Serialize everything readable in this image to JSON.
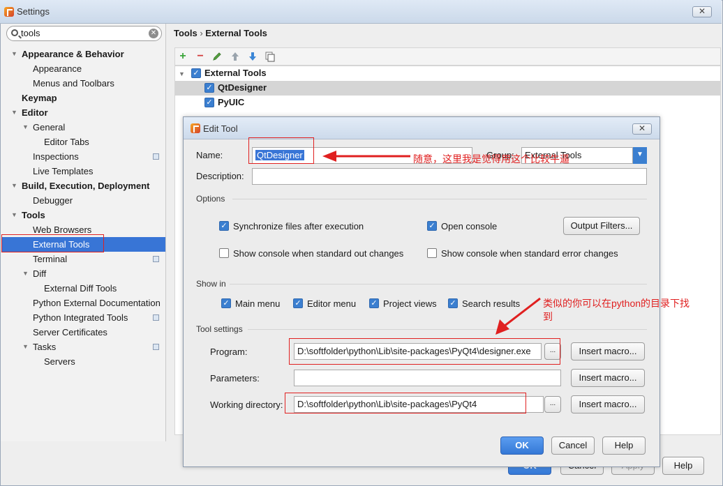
{
  "window": {
    "title": "Settings",
    "close_label": "✕"
  },
  "search": {
    "value": "tools"
  },
  "tree": [
    {
      "label": "Appearance & Behavior",
      "level": 0,
      "bold": true,
      "expanded": true
    },
    {
      "label": "Appearance",
      "level": 1
    },
    {
      "label": "Menus and Toolbars",
      "level": 1
    },
    {
      "label": "Keymap",
      "level": 0,
      "bold": true
    },
    {
      "label": "Editor",
      "level": 0,
      "bold": true,
      "expanded": true
    },
    {
      "label": "General",
      "level": 1,
      "expanded": true
    },
    {
      "label": "Editor Tabs",
      "level": 2
    },
    {
      "label": "Inspections",
      "level": 1,
      "project_icon": true
    },
    {
      "label": "Live Templates",
      "level": 1
    },
    {
      "label": "Build, Execution, Deployment",
      "level": 0,
      "bold": true,
      "expanded": true
    },
    {
      "label": "Debugger",
      "level": 1
    },
    {
      "label": "Tools",
      "level": 0,
      "bold": true,
      "expanded": true
    },
    {
      "label": "Web Browsers",
      "level": 1
    },
    {
      "label": "External Tools",
      "level": 1,
      "selected": true
    },
    {
      "label": "Terminal",
      "level": 1,
      "project_icon": true
    },
    {
      "label": "Diff",
      "level": 1,
      "expanded": true
    },
    {
      "label": "External Diff Tools",
      "level": 2
    },
    {
      "label": "Python External Documentation",
      "level": 1
    },
    {
      "label": "Python Integrated Tools",
      "level": 1,
      "project_icon": true
    },
    {
      "label": "Server Certificates",
      "level": 1
    },
    {
      "label": "Tasks",
      "level": 1,
      "expanded": true,
      "project_icon": true
    },
    {
      "label": "Servers",
      "level": 2
    }
  ],
  "breadcrumb": {
    "part1": "Tools",
    "sep": "›",
    "part2": "External Tools"
  },
  "toolbar": {
    "add_icon": "plus-icon",
    "remove_icon": "minus-icon",
    "edit_icon": "pencil-icon",
    "up_icon": "arrow-up-icon",
    "down_icon": "arrow-down-icon",
    "copy_icon": "copy-icon"
  },
  "tools_list": {
    "group": "External Tools",
    "items": [
      "QtDesigner",
      "PyUIC"
    ]
  },
  "main_buttons": {
    "ok": "OK",
    "cancel": "Cancel",
    "apply": "Apply",
    "help": "Help"
  },
  "dialog": {
    "title": "Edit Tool",
    "name_label": "Name:",
    "name_value": "QtDesigner",
    "group_label": "Group:",
    "group_value": "External Tools",
    "description_label": "Description:",
    "description_value": "",
    "options_label": "Options",
    "options": {
      "sync_files": {
        "label": "Synchronize files after execution",
        "checked": true
      },
      "open_console": {
        "label": "Open console",
        "checked": true
      },
      "show_std_out": {
        "label": "Show console when standard out changes",
        "checked": false
      },
      "show_std_err": {
        "label": "Show console when standard error changes",
        "checked": false
      },
      "output_filters": "Output Filters..."
    },
    "show_in_label": "Show in",
    "show_in": {
      "main_menu": {
        "label": "Main menu",
        "checked": true
      },
      "editor_menu": {
        "label": "Editor menu",
        "checked": true
      },
      "project_views": {
        "label": "Project views",
        "checked": true
      },
      "search_results": {
        "label": "Search results",
        "checked": true
      }
    },
    "tool_settings_label": "Tool settings",
    "program_label": "Program:",
    "program_value": "D:\\softfolder\\python\\Lib\\site-packages\\PyQt4\\designer.exe",
    "parameters_label": "Parameters:",
    "parameters_value": "",
    "working_dir_label": "Working directory:",
    "working_dir_value": "D:\\softfolder\\python\\Lib\\site-packages\\PyQt4",
    "browse_label": "...",
    "insert_macro": "Insert macro...",
    "ok": "OK",
    "cancel": "Cancel",
    "help": "Help"
  },
  "annotations": {
    "name_note": "随意，这里我是觉得用这个比较牛逼",
    "program_note_line1": "类似的你可以在python的目录下找",
    "program_note_line2": "到"
  },
  "colors": {
    "accent": "#3875d6",
    "annotation": "#e02020"
  }
}
